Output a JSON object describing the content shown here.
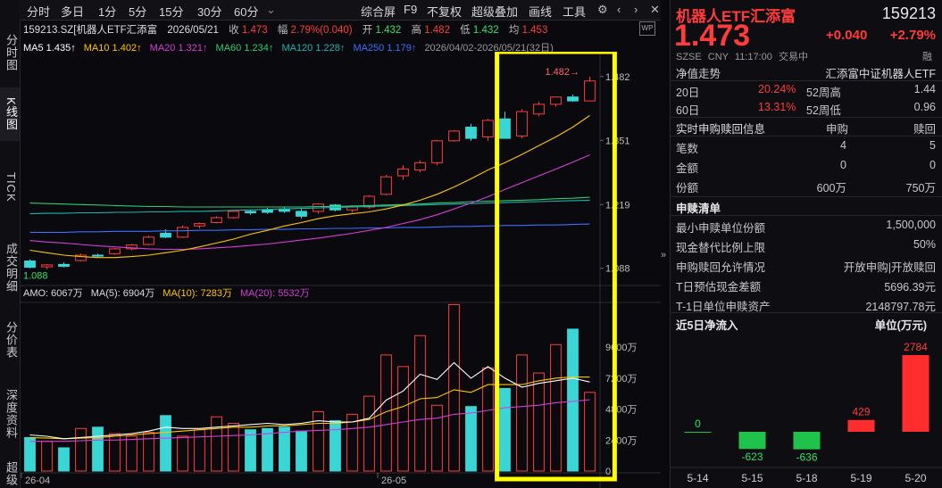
{
  "sidebar": {
    "items": [
      "分时图",
      "K线图",
      "TICK",
      "成交明细",
      "分价表",
      "深度资料",
      "超级"
    ]
  },
  "toolbar": {
    "left": [
      "分时",
      "多日",
      "1分",
      "5分",
      "15分",
      "30分",
      "60分"
    ],
    "right": [
      "综合屏",
      "F9",
      "不复权",
      "超级叠加",
      "画线",
      "工具"
    ]
  },
  "header": {
    "code": "159213.SZ[机器人ETF汇添富",
    "date": "2026/05/21",
    "close_label": "收",
    "close": "1.473",
    "chg_label": "幅",
    "chg": "2.79%(0.040)",
    "open_label": "开",
    "open": "1.432",
    "high_label": "高",
    "high": "1.482",
    "low_label": "低",
    "low": "1.432",
    "avg_label": "均",
    "avg": "1.453"
  },
  "ma_line": {
    "ma5": "MA5 1.435↑",
    "ma10": "MA10 1.402↑",
    "ma20": "MA20 1.321↑",
    "ma60": "MA60 1.234↑",
    "ma120": "MA120 1.228↑",
    "ma250": "MA250 1.179↑",
    "range": "2026/04/02-2026/05/21(32日)"
  },
  "price_axis": [
    "1.482",
    "1.351",
    "1.219",
    "1.088"
  ],
  "price_marks": {
    "high": "1.482→",
    "low": "1.088"
  },
  "amo_line": {
    "amo": "AMO: 6067万",
    "ma5": "MA(5): 6904万",
    "ma10": "MA(10): 7283万",
    "ma20": "MA(20): 5532万"
  },
  "vol_axis": [
    "9600万",
    "7200万",
    "4800万",
    "2400万",
    "0"
  ],
  "date_axis": [
    "26-04",
    "26-05"
  ],
  "colors": {
    "up": "#ff3b3b",
    "down": "#3ad6d6",
    "ma5": "#ffffff",
    "ma10": "#ffc400",
    "ma20": "#d23fd6",
    "ma60": "#2ecc71",
    "ma120": "#20b2aa",
    "ma250": "#3a6fff",
    "highlight": "#ffff00"
  },
  "chart_data": {
    "type": "candlestick",
    "ylim": [
      1.06,
      1.5
    ],
    "candles": [
      {
        "o": 1.103,
        "h": 1.106,
        "l": 1.088,
        "c": 1.09
      },
      {
        "o": 1.091,
        "h": 1.097,
        "l": 1.086,
        "c": 1.095
      },
      {
        "o": 1.096,
        "h": 1.1,
        "l": 1.09,
        "c": 1.092
      },
      {
        "o": 1.104,
        "h": 1.118,
        "l": 1.102,
        "c": 1.115
      },
      {
        "o": 1.115,
        "h": 1.118,
        "l": 1.11,
        "c": 1.113
      },
      {
        "o": 1.118,
        "h": 1.13,
        "l": 1.116,
        "c": 1.128
      },
      {
        "o": 1.128,
        "h": 1.138,
        "l": 1.125,
        "c": 1.136
      },
      {
        "o": 1.137,
        "h": 1.155,
        "l": 1.135,
        "c": 1.152
      },
      {
        "o": 1.16,
        "h": 1.168,
        "l": 1.15,
        "c": 1.152
      },
      {
        "o": 1.152,
        "h": 1.176,
        "l": 1.15,
        "c": 1.172
      },
      {
        "o": 1.175,
        "h": 1.182,
        "l": 1.17,
        "c": 1.18
      },
      {
        "o": 1.182,
        "h": 1.195,
        "l": 1.18,
        "c": 1.192
      },
      {
        "o": 1.192,
        "h": 1.205,
        "l": 1.19,
        "c": 1.205
      },
      {
        "o": 1.205,
        "h": 1.208,
        "l": 1.198,
        "c": 1.202
      },
      {
        "o": 1.208,
        "h": 1.212,
        "l": 1.2,
        "c": 1.203
      },
      {
        "o": 1.21,
        "h": 1.214,
        "l": 1.202,
        "c": 1.205
      },
      {
        "o": 1.205,
        "h": 1.21,
        "l": 1.19,
        "c": 1.195
      },
      {
        "o": 1.205,
        "h": 1.222,
        "l": 1.2,
        "c": 1.22
      },
      {
        "o": 1.218,
        "h": 1.22,
        "l": 1.205,
        "c": 1.208
      },
      {
        "o": 1.208,
        "h": 1.218,
        "l": 1.203,
        "c": 1.214
      },
      {
        "o": 1.214,
        "h": 1.238,
        "l": 1.21,
        "c": 1.236
      },
      {
        "o": 1.24,
        "h": 1.28,
        "l": 1.238,
        "c": 1.276
      },
      {
        "o": 1.278,
        "h": 1.3,
        "l": 1.27,
        "c": 1.292
      },
      {
        "o": 1.29,
        "h": 1.31,
        "l": 1.285,
        "c": 1.305
      },
      {
        "o": 1.305,
        "h": 1.352,
        "l": 1.3,
        "c": 1.35
      },
      {
        "o": 1.35,
        "h": 1.372,
        "l": 1.348,
        "c": 1.37
      },
      {
        "o": 1.378,
        "h": 1.385,
        "l": 1.35,
        "c": 1.355
      },
      {
        "o": 1.358,
        "h": 1.395,
        "l": 1.35,
        "c": 1.392
      },
      {
        "o": 1.395,
        "h": 1.41,
        "l": 1.36,
        "c": 1.355
      },
      {
        "o": 1.36,
        "h": 1.415,
        "l": 1.355,
        "c": 1.41
      },
      {
        "o": 1.405,
        "h": 1.43,
        "l": 1.4,
        "c": 1.425
      },
      {
        "o": 1.425,
        "h": 1.44,
        "l": 1.42,
        "c": 1.44
      },
      {
        "o": 1.44,
        "h": 1.445,
        "l": 1.43,
        "c": 1.432
      },
      {
        "o": 1.432,
        "h": 1.482,
        "l": 1.432,
        "c": 1.473
      }
    ],
    "ma5_y": [
      1.106,
      1.104,
      1.101,
      1.102,
      1.105,
      1.11,
      1.118,
      1.128,
      1.138,
      1.145,
      1.155,
      1.165,
      1.178,
      1.188,
      1.196,
      1.2,
      1.201,
      1.205,
      1.208,
      1.21,
      1.215,
      1.225,
      1.24,
      1.26,
      1.284,
      1.31,
      1.33,
      1.35,
      1.36,
      1.375,
      1.39,
      1.4,
      1.415,
      1.435
    ],
    "ma10_y": [
      1.125,
      1.12,
      1.115,
      1.112,
      1.11,
      1.11,
      1.112,
      1.115,
      1.12,
      1.125,
      1.132,
      1.14,
      1.148,
      1.158,
      1.166,
      1.175,
      1.182,
      1.19,
      1.196,
      1.2,
      1.204,
      1.21,
      1.218,
      1.228,
      1.24,
      1.255,
      1.272,
      1.29,
      1.305,
      1.322,
      1.34,
      1.358,
      1.378,
      1.402
    ],
    "ma20_y": [
      1.145,
      1.142,
      1.14,
      1.137,
      1.134,
      1.132,
      1.13,
      1.128,
      1.127,
      1.127,
      1.128,
      1.13,
      1.132,
      1.135,
      1.138,
      1.142,
      1.146,
      1.15,
      1.155,
      1.16,
      1.166,
      1.172,
      1.18,
      1.188,
      1.198,
      1.21,
      1.222,
      1.235,
      1.25,
      1.264,
      1.278,
      1.292,
      1.306,
      1.321
    ],
    "ma60_y": [
      1.222,
      1.221,
      1.22,
      1.219,
      1.218,
      1.217,
      1.216,
      1.215,
      1.215,
      1.214,
      1.214,
      1.214,
      1.214,
      1.214,
      1.214,
      1.214,
      1.214,
      1.215,
      1.215,
      1.216,
      1.217,
      1.218,
      1.219,
      1.22,
      1.222,
      1.223,
      1.225,
      1.226,
      1.227,
      1.228,
      1.229,
      1.231,
      1.232,
      1.234
    ],
    "ma120_y": [
      1.2,
      1.201,
      1.201,
      1.202,
      1.202,
      1.203,
      1.203,
      1.204,
      1.204,
      1.205,
      1.205,
      1.206,
      1.207,
      1.208,
      1.209,
      1.21,
      1.211,
      1.212,
      1.213,
      1.214,
      1.215,
      1.216,
      1.217,
      1.218,
      1.219,
      1.22,
      1.221,
      1.222,
      1.223,
      1.224,
      1.225,
      1.226,
      1.227,
      1.228
    ],
    "ma250_y": [
      1.162,
      1.162,
      1.162,
      1.163,
      1.163,
      1.164,
      1.164,
      1.164,
      1.165,
      1.165,
      1.166,
      1.166,
      1.167,
      1.167,
      1.168,
      1.168,
      1.169,
      1.169,
      1.17,
      1.17,
      1.171,
      1.171,
      1.172,
      1.172,
      1.173,
      1.174,
      1.174,
      1.175,
      1.176,
      1.176,
      1.177,
      1.177,
      1.178,
      1.179
    ],
    "volume": [
      2600,
      2300,
      1800,
      3300,
      3400,
      2900,
      2700,
      3000,
      4300,
      2700,
      3200,
      4200,
      3700,
      3200,
      3300,
      3400,
      3100,
      4600,
      3900,
      4400,
      5800,
      9000,
      8100,
      10500,
      5100,
      12900,
      5000,
      8000,
      6400,
      9000,
      7600,
      9800,
      11000,
      6100
    ],
    "volume_ylim": [
      0,
      13000
    ],
    "vol_ma5": [
      2800,
      2700,
      2500,
      2600,
      2700,
      2800,
      2900,
      3100,
      3400,
      3300,
      3300,
      3400,
      3500,
      3600,
      3700,
      3600,
      3700,
      3900,
      3800,
      3800,
      4100,
      5500,
      6200,
      7500,
      7100,
      8400,
      7200,
      8100,
      7200,
      6500,
      6800,
      7000,
      7200,
      6904
    ],
    "vol_ma10": [
      2600,
      2550,
      2500,
      2550,
      2600,
      2700,
      2800,
      2900,
      3000,
      3100,
      3200,
      3300,
      3400,
      3400,
      3500,
      3500,
      3600,
      3700,
      3700,
      3800,
      4000,
      4600,
      5000,
      5600,
      5700,
      6300,
      6100,
      6700,
      6700,
      6700,
      7000,
      7200,
      7300,
      7283
    ],
    "vol_ma20": [
      2300,
      2300,
      2300,
      2350,
      2400,
      2400,
      2450,
      2500,
      2550,
      2600,
      2650,
      2700,
      2750,
      2800,
      2900,
      3000,
      3100,
      3150,
      3200,
      3300,
      3400,
      3600,
      3800,
      4000,
      4100,
      4400,
      4500,
      4700,
      4900,
      5000,
      5100,
      5300,
      5400,
      5532
    ]
  },
  "right": {
    "title": "机器人ETF汇添富",
    "code": "159213",
    "price": "1.473",
    "change": "+0.040",
    "pct": "+2.79%",
    "sub": {
      "exchange": "SZSE",
      "currency": "CNY",
      "time": "11:17:00",
      "status": "交易中",
      "mark": "融"
    },
    "nav_label": "净值走势",
    "nav_name": "汇添富中证机器人ETF",
    "stats": [
      {
        "k1": "20日",
        "v1": "20.24%",
        "k2": "52周高",
        "v2": "1.44"
      },
      {
        "k1": "60日",
        "v1": "13.31%",
        "k2": "52周低",
        "v2": "0.96"
      }
    ],
    "sub_header": {
      "title": "实时申购赎回信息",
      "c1": "申购",
      "c2": "赎回"
    },
    "sub_rows": [
      {
        "k": "笔数",
        "a": "4",
        "b": "5"
      },
      {
        "k": "金额",
        "a": "0",
        "b": "0"
      },
      {
        "k": "份额",
        "a": "600万",
        "b": "750万"
      }
    ],
    "list_title": "申赎清单",
    "list_rows": [
      {
        "k": "最小申赎单位份额",
        "v": "1,500,000"
      },
      {
        "k": "现金替代比例上限",
        "v": "50%"
      },
      {
        "k": "申购赎回允许情况",
        "v": "开放申购|开放赎回"
      },
      {
        "k": "T日预估现金差额",
        "v": "5696.39元"
      },
      {
        "k": "T-1日单位申赎资产",
        "v": "2148797.78元"
      }
    ],
    "flow_title": "近5日净流入",
    "flow_unit": "单位(万元)",
    "flow": {
      "type": "bar",
      "categories": [
        "5-14",
        "5-15",
        "5-18",
        "5-19",
        "5-20"
      ],
      "values": [
        0,
        -623,
        -636,
        429,
        2784
      ]
    }
  }
}
